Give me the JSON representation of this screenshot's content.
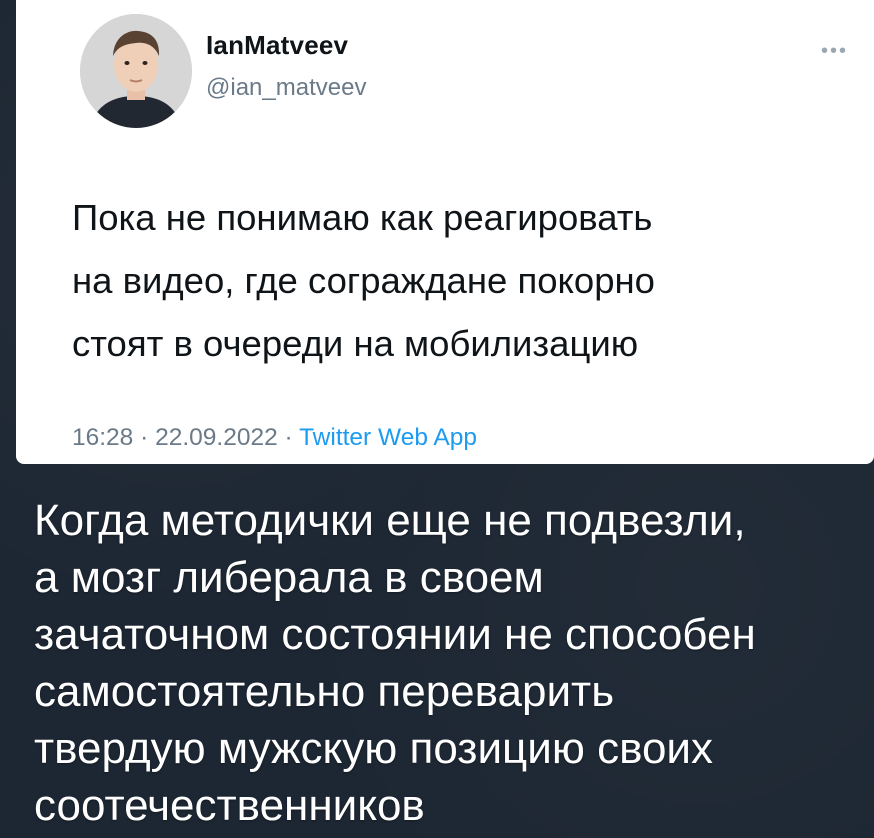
{
  "tweet": {
    "display_name": "IanMatveev",
    "handle": "@ian_matveev",
    "more_icon": "more-dots-icon",
    "text": "Пока не понимаю как реагировать\nна видео, где сограждане покорно\nстоят в очереди на мобилизацию",
    "time": "16:28",
    "separator": " · ",
    "date": "22.09.2022",
    "source": "Twitter Web App",
    "colors": {
      "text": "#0f1419",
      "muted": "#6b7a88",
      "link": "#1d9bf0"
    }
  },
  "caption": {
    "text": "Когда методички еще не подвезли,\nа мозг либерала в своем\nзачаточном состоянии не способен\nсамостоятельно переварить\nтвердую мужскую позицию своих\nсоотечественников"
  },
  "colors": {
    "background": "#1d2733",
    "card": "#ffffff",
    "caption": "#ffffff"
  }
}
